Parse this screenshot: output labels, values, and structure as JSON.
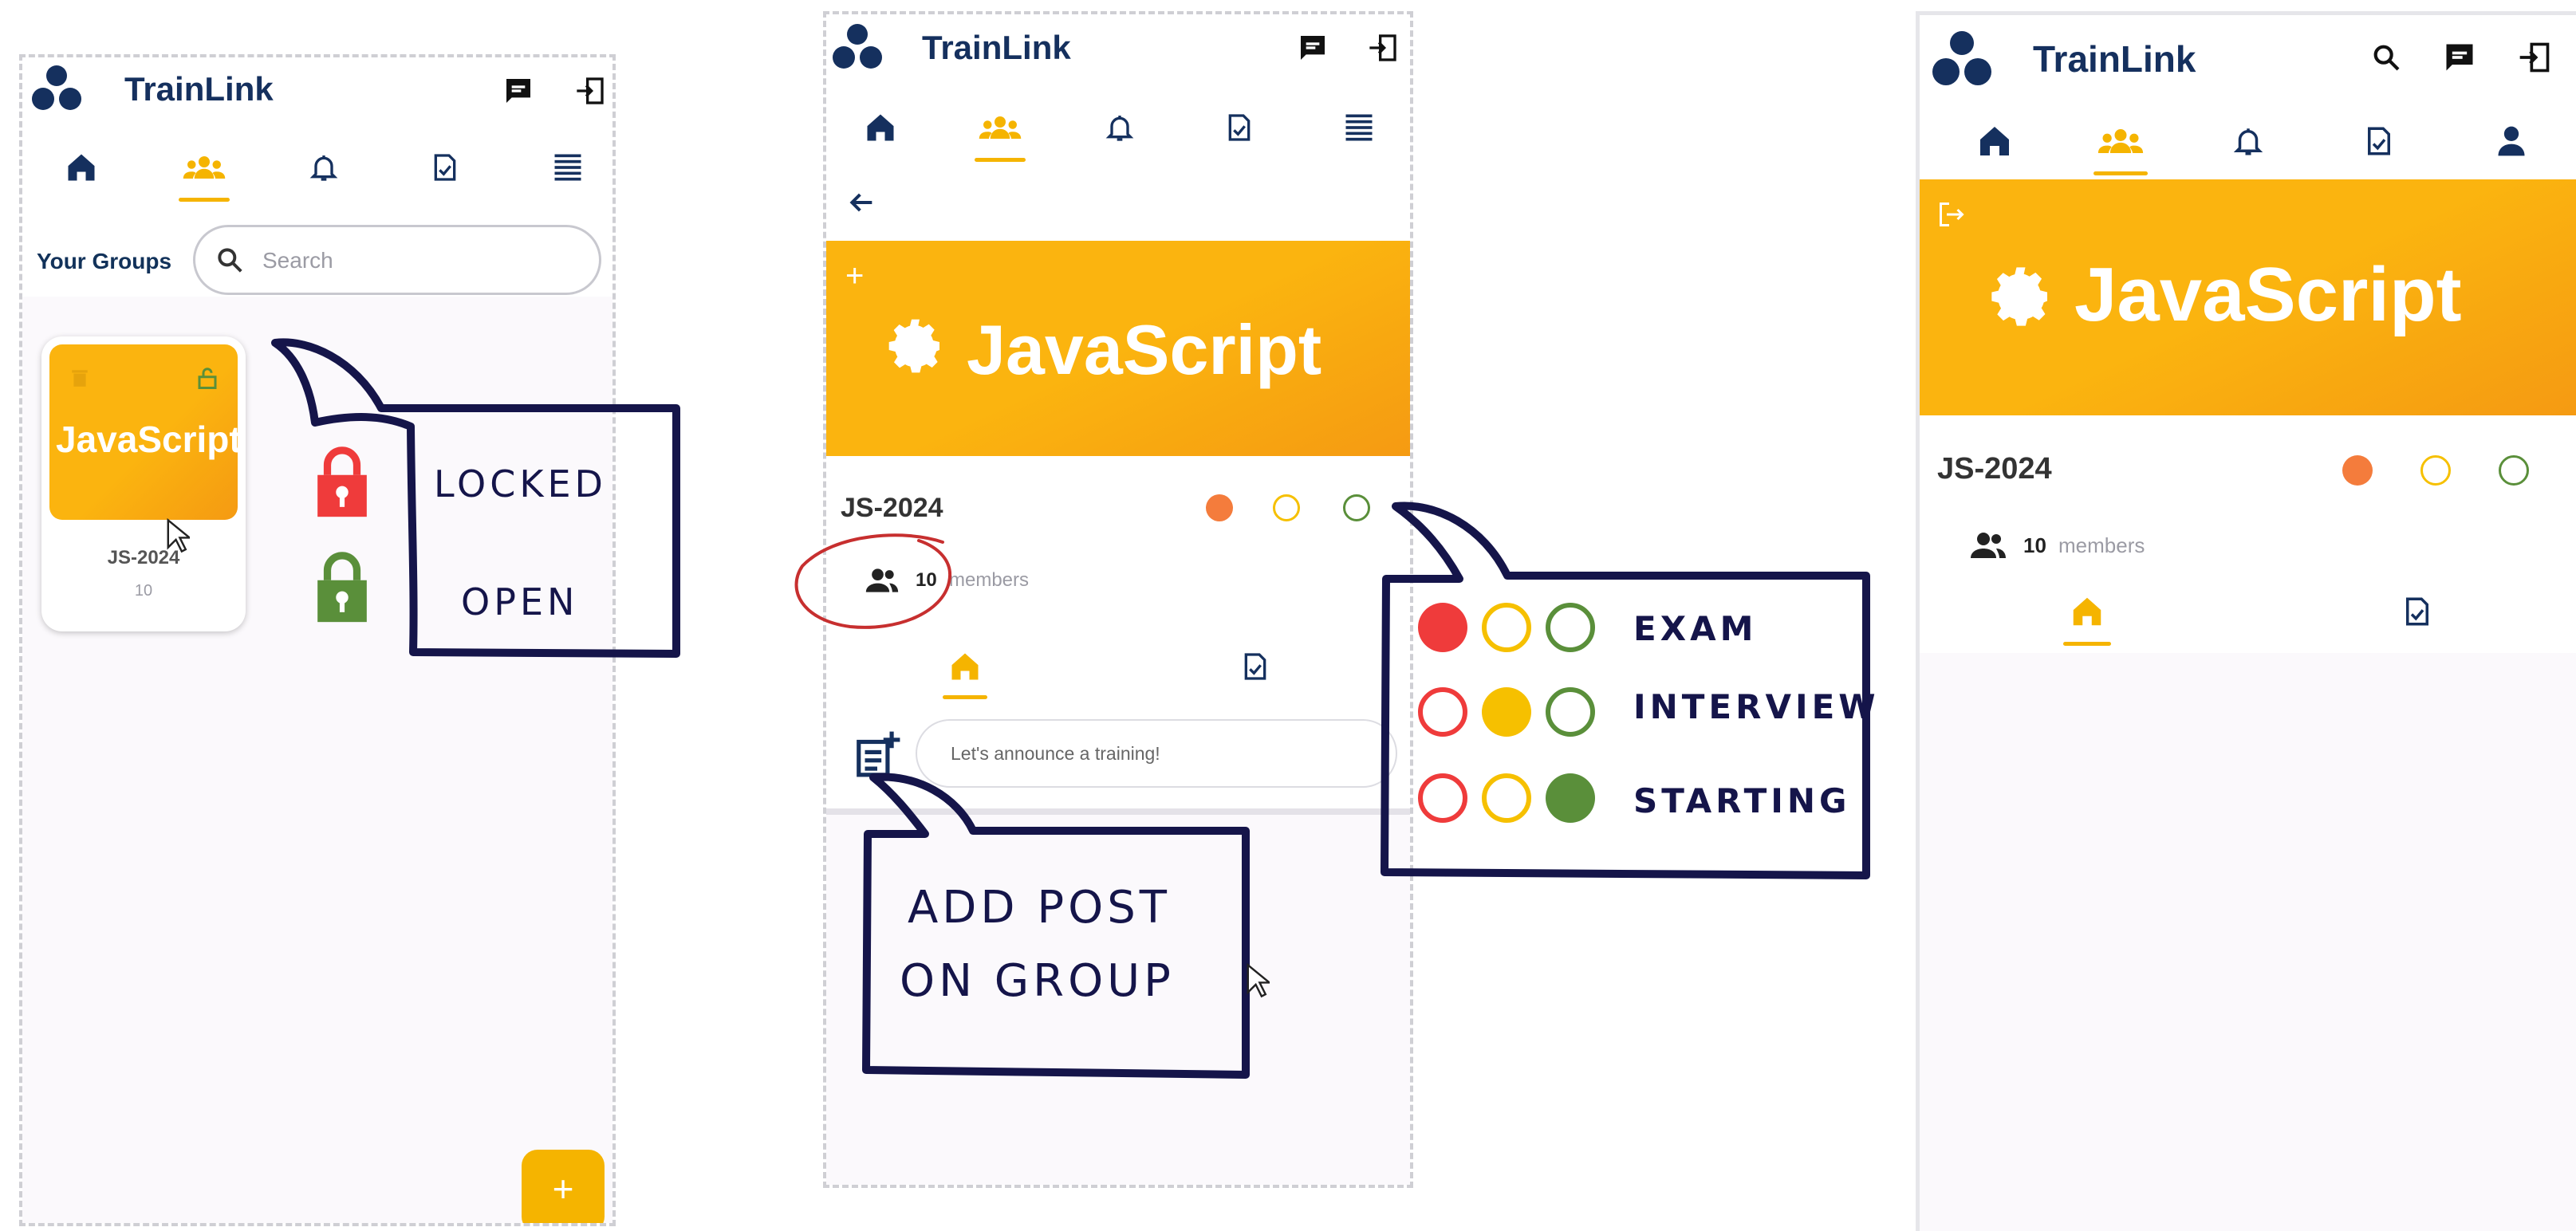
{
  "app": {
    "title": "TrainLink"
  },
  "panel_list": {
    "your_groups_label": "Your Groups",
    "search_placeholder": "Search",
    "group_card": {
      "banner_text": "JavaScript",
      "name": "JS-2024",
      "members_count": "10"
    },
    "fab_label": "+"
  },
  "panel_group": {
    "banner_text": "JavaScript",
    "banner_plus": "+",
    "group_name": "JS-2024",
    "members_count": "10",
    "members_label": "members",
    "post_placeholder": "Let's announce a training!"
  },
  "panel_detail": {
    "banner_text": "JavaScript",
    "group_name": "JS-2024",
    "members_count": "10",
    "members_label": "members"
  },
  "callouts": {
    "locked_label": "LOCKED",
    "open_label": "OPEN",
    "add_post_line1": "ADD POST",
    "add_post_line2": "ON GROUP",
    "legend": [
      "EXAM",
      "INTERVIEW",
      "STARTING"
    ]
  },
  "colors": {
    "brand_navy": "#15305e",
    "accent_yellow": "#f5b400",
    "banner_orange": "#fbb40f",
    "status_red": "#ef3b3b",
    "status_orange": "#f47c3c",
    "status_yellow": "#f6c000",
    "status_green": "#5a8f3a",
    "callout_ink": "#15154a"
  },
  "icons": [
    "logo-icon",
    "chat-icon",
    "logout-icon",
    "home-icon",
    "groups-icon",
    "bell-icon",
    "tasks-icon",
    "menu-icon",
    "search-icon",
    "back-arrow-icon",
    "add-post-icon",
    "person-icon",
    "members-icon",
    "trash-icon",
    "lock-icon",
    "gear-icon",
    "cursor-icon"
  ]
}
